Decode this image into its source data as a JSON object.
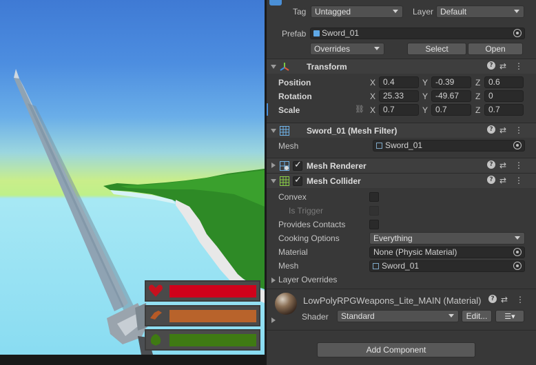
{
  "scene": {
    "health_color": "#d0021b",
    "stamina_color": "#b8632b",
    "mana_color": "#3f7a13",
    "icons": [
      "heart-icon",
      "boot-icon",
      "leaf-icon"
    ]
  },
  "object": {
    "tag_label": "Tag",
    "tag_value": "Untagged",
    "layer_label": "Layer",
    "layer_value": "Default",
    "prefab_label": "Prefab",
    "prefab_value": "Sword_01",
    "overrides_label": "Overrides",
    "select_label": "Select",
    "open_label": "Open"
  },
  "transform": {
    "title": "Transform",
    "position_label": "Position",
    "rotation_label": "Rotation",
    "scale_label": "Scale",
    "axes": [
      "X",
      "Y",
      "Z"
    ],
    "position": [
      "0.4",
      "-0.39",
      "0.6"
    ],
    "rotation": [
      "25.33",
      "-49.67",
      "0"
    ],
    "scale": [
      "0.7",
      "0.7",
      "0.7"
    ]
  },
  "mesh_filter": {
    "title": "Sword_01 (Mesh Filter)",
    "mesh_label": "Mesh",
    "mesh_value": "Sword_01"
  },
  "mesh_renderer": {
    "title": "Mesh Renderer",
    "enabled": true
  },
  "mesh_collider": {
    "title": "Mesh Collider",
    "enabled": true,
    "convex_label": "Convex",
    "is_trigger_label": "Is Trigger",
    "provides_contacts_label": "Provides Contacts",
    "cooking_options_label": "Cooking Options",
    "cooking_options_value": "Everything",
    "material_label": "Material",
    "material_value": "None (Physic Material)",
    "mesh_label": "Mesh",
    "mesh_value": "Sword_01",
    "layer_overrides_label": "Layer Overrides"
  },
  "material": {
    "title": "LowPolyRPGWeapons_Lite_MAIN (Material)",
    "shader_label": "Shader",
    "shader_value": "Standard",
    "edit_label": "Edit..."
  },
  "add_component_label": "Add Component"
}
